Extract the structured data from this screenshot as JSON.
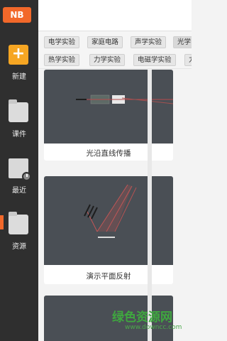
{
  "app": {
    "logo": "NB"
  },
  "sidebar": {
    "items": [
      {
        "label": "新建",
        "icon": "plus-icon"
      },
      {
        "label": "课件",
        "icon": "folder-icon"
      },
      {
        "label": "最近",
        "icon": "recent-doc-icon"
      },
      {
        "label": "资源",
        "icon": "folder-icon",
        "active": true
      }
    ],
    "accent": "#f2682a"
  },
  "filters": {
    "row1": [
      "电学实验",
      "家庭电路",
      "声学实验",
      "光学"
    ],
    "row2": [
      "热学实验",
      "力学实验",
      "电磁学实验",
      "力"
    ]
  },
  "cards": [
    {
      "title": "光沿直线传播"
    },
    {
      "title": "演示平面反射"
    },
    {
      "title": ""
    }
  ],
  "watermark": {
    "text": "绿色资源网",
    "url": "www.downcc.com"
  }
}
